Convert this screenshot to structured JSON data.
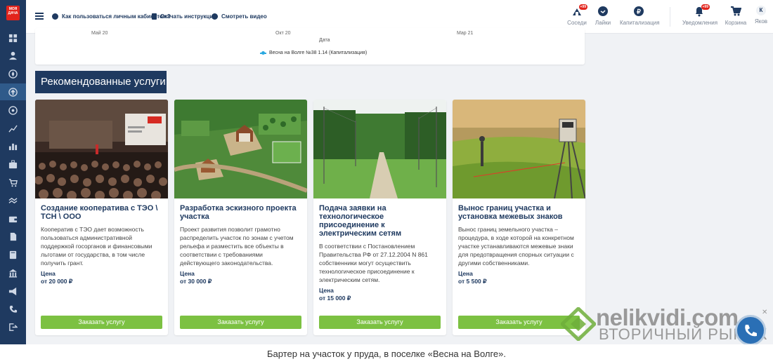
{
  "sidebar": {
    "logo_text": "МОЯ ДАЧА",
    "icons": [
      "dashboard-icon",
      "user-icon",
      "compass-icon",
      "home-upload-icon",
      "target-icon",
      "line-chart-icon",
      "bar-chart-icon",
      "briefcase-icon",
      "cart-icon",
      "handshake-icon",
      "wallet-icon",
      "document-icon",
      "book-icon",
      "building-icon",
      "megaphone-icon",
      "phone-icon",
      "logout-icon"
    ],
    "active_index": 3
  },
  "header": {
    "links": [
      {
        "label": "Как пользоваться личным кабинетом?"
      },
      {
        "label": "Скачать инструкцию"
      },
      {
        "label": "Смотреть видео"
      }
    ],
    "nav": [
      {
        "label": "Соседи",
        "badge": "+99"
      },
      {
        "label": "Лайки",
        "badge": ""
      },
      {
        "label": "Капитализация",
        "badge": ""
      },
      {
        "label": "Уведомления",
        "badge": "+99"
      },
      {
        "label": "Корзина",
        "badge": ""
      },
      {
        "label": "Яков",
        "avatar": "К"
      }
    ]
  },
  "chart": {
    "xticks": [
      "Май 20",
      "Окт 20",
      "Мар 21"
    ],
    "xlabel": "Дата",
    "legend": "Весна на Волге №38 1.14 (Капитализация)"
  },
  "section_title": "Рекомендованные услуги",
  "cards": [
    {
      "title": "Создание кооператива с ТЭО \\ ТСН \\ ООО",
      "description": "Кооператив с ТЭО дает возможность пользоваться административной поддержкой госорганов и финансовыми льготами от государства, в том числе получить грант.",
      "price_label": "Цена",
      "price": "от 20 000 ₽",
      "button": "Заказать услугу"
    },
    {
      "title": "Разработка эскизного проекта участка",
      "description": "Проект развития позволит грамотно распределить участок по зонам с учетом рельефа и разместить все объекты в соответствии с требованиями действующего законодательства.",
      "price_label": "Цена",
      "price": "от 30 000 ₽",
      "button": "Заказать услугу"
    },
    {
      "title": "Подача заявки на технологическое присоединение к электрическим сетям",
      "description": "В соответствии с Постановлением Правительства РФ от 27.12.2004 N 861 собственники могут осуществить технологическое присоединение к электрическим сетям.",
      "price_label": "Цена",
      "price": "от 15 000 ₽",
      "button": "Заказать услугу"
    },
    {
      "title": "Вынос границ участка и установка межевых знаков",
      "description": "Вынос границ земельного участка – процедура, в ходе которой на конкретном участке устанавливаются межевые знаки для предотвращения спорных ситуации с другими собственниками.",
      "price_label": "Цена",
      "price": "от 5 500 ₽",
      "button": "Заказать услугу"
    }
  ],
  "caption": "Бартер на участок у пруда, в поселке «Весна на Волге».",
  "watermark": {
    "top": "nelikvidi.com",
    "bottom": "ВТОРИЧНЫЙ РЫНОК"
  },
  "colors": {
    "primary": "#1f3a60",
    "accent_green": "#7cc142",
    "badge_red": "#e2241c",
    "series_blue": "#29a8e0"
  }
}
